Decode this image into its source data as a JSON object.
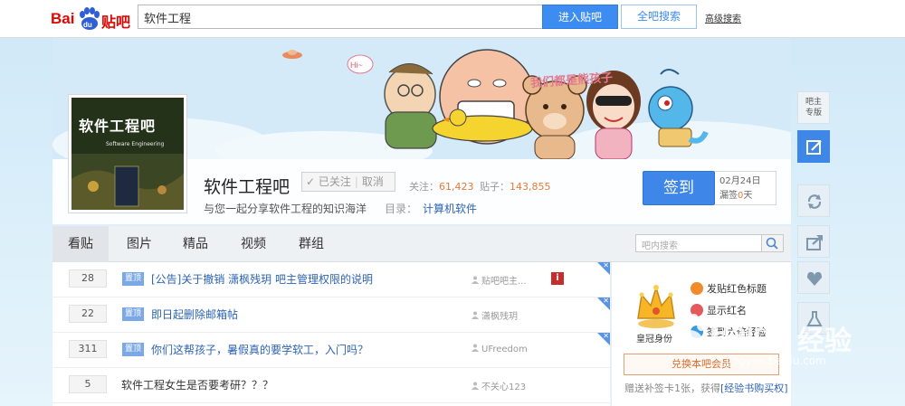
{
  "header": {
    "logo_prefix": "Bai",
    "logo_paw": "du",
    "logo_suffix": "贴吧",
    "search_value": "软件工程",
    "enter_button": "进入贴吧",
    "all_search_button": "全吧搜索",
    "advanced_search": "高级搜索"
  },
  "banner": {
    "title": "我们都是熊孩子",
    "speech": "Hi~"
  },
  "avatar": {
    "title": "软件工程吧",
    "subtitle": "Software Engineering"
  },
  "forum": {
    "name": "软件工程吧",
    "follow_label": "已关注",
    "unfollow_label": "取消",
    "follow_label_full": "✓ 已关注",
    "followers_label": "关注：",
    "followers_value": "61,423",
    "posts_label": "贴子：",
    "posts_value": "143,855",
    "slogan": "与您一起分享软件工程的知识海洋",
    "catalog_label": "目录：",
    "catalog_value": "计算机软件"
  },
  "sign": {
    "button": "签到",
    "date": "02月24日",
    "missed_prefix": "漏签",
    "missed_days": "0",
    "missed_suffix": "天"
  },
  "tabs": [
    {
      "label": "看贴"
    },
    {
      "label": "图片"
    },
    {
      "label": "精品"
    },
    {
      "label": "视频"
    },
    {
      "label": "群组"
    }
  ],
  "forum_search_placeholder": "吧内搜索",
  "threads": [
    {
      "replies": "28",
      "pinned": "置顶",
      "title": "[公告]关于撤销 潇枫残玥 吧主管理权限的说明",
      "author": "贴吧吧主..."
    },
    {
      "replies": "22",
      "pinned": "置顶",
      "title": "即日起删除邮箱帖",
      "author": "潇枫残玥"
    },
    {
      "replies": "311",
      "pinned": "置顶",
      "title": "你们这帮孩子，暑假真的要学软工，入门吗？",
      "author": "UFreedom"
    },
    {
      "replies": "5",
      "pinned": "",
      "title": "软件工程女生是否要考研？？？",
      "author": "不关心123"
    }
  ],
  "member_panel": {
    "crown_label": "皇冠身份",
    "privileges": [
      "发贴红色标题",
      "显示红名",
      "签到六倍经验"
    ],
    "exchange_button": "兑换本吧会员",
    "gift_text": "赠送补签卡1张，获得",
    "gift_link": "[经验书购买权]"
  },
  "float_bar": {
    "admin_label_1": "吧主",
    "admin_label_2": "专版"
  },
  "watermark": {
    "brand": "Baidu",
    "brand_cn": "经验",
    "url": "jingyan.baidu.com"
  }
}
